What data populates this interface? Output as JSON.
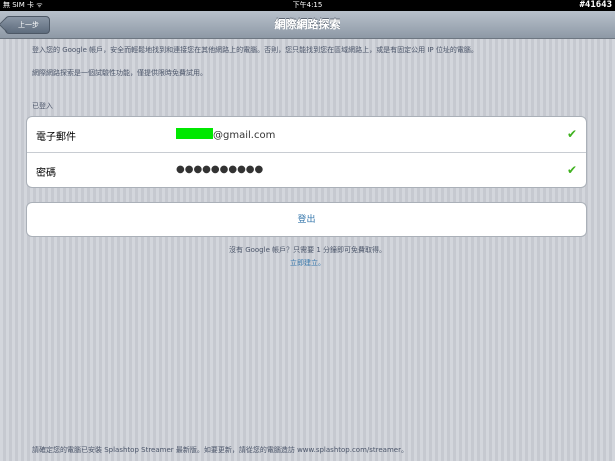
{
  "status_bar": {
    "carrier": "無 SIM 卡 ᯤ",
    "time": "下午4:15",
    "watermark": "#41643"
  },
  "nav": {
    "back_label": "上一步",
    "title": "網際網路探索"
  },
  "info": {
    "line1": "登入您的 Google 帳戶，安全而輕鬆地找到和連接您在其他網路上的電腦。否則，您只能找到您在區域網路上，或是有固定公用 IP 位址的電腦。",
    "line2": "網際網路探索是一個試驗性功能，僅提供限時免費試用。"
  },
  "section_label": "已登入",
  "login": {
    "email_label": "電子郵件",
    "email_suffix": "@gmail.com",
    "password_label": "密碼",
    "password_value": "●●●●●●●●●●",
    "email_check": "✔",
    "password_check": "✔"
  },
  "signout_label": "登出",
  "signup": {
    "prompt": "沒有 Google 帳戶？只需要 1 分鐘即可免費取得。",
    "link": "立即建立。"
  },
  "bottom_note": "請確定您的電腦已安裝 Splashtop Streamer 最新版。如要更新，請從您的電腦造訪 www.splashtop.com/streamer。",
  "colors": {
    "accent_link": "#3677ac",
    "check": "#3fb21f",
    "redaction": "#00e800"
  }
}
